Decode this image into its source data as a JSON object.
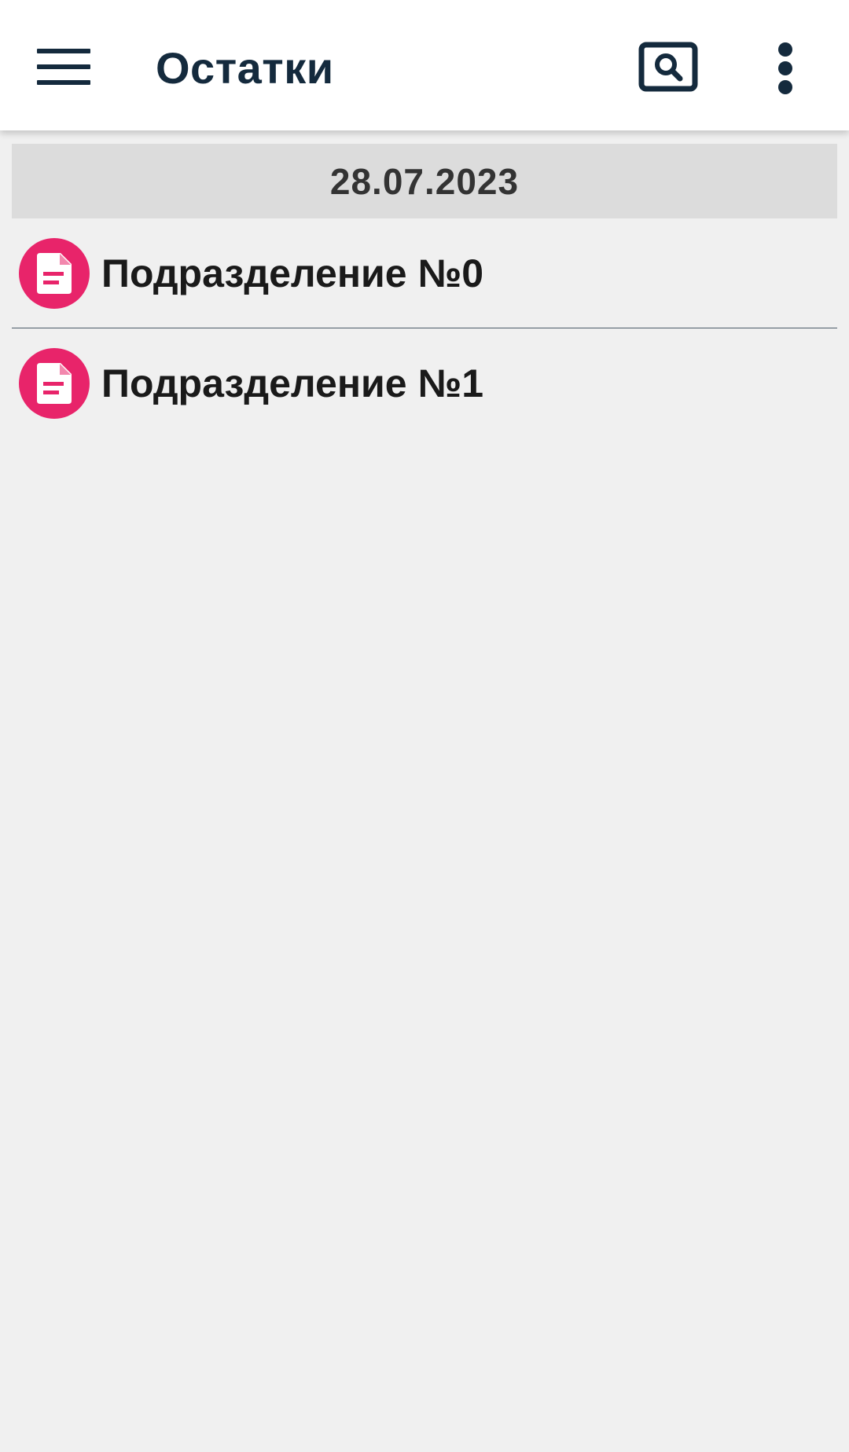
{
  "app_bar": {
    "menu_icon": "hamburger-menu-icon",
    "title": "Остатки",
    "search_icon": "search-icon",
    "more_icon": "more-vert-icon"
  },
  "list": {
    "date_header": "28.07.2023",
    "items": [
      {
        "label": "Подразделение №0",
        "icon": "document-icon"
      },
      {
        "label": "Подразделение №1",
        "icon": "document-icon"
      }
    ]
  },
  "colors": {
    "primary_dark": "#142a3d",
    "accent_pink": "#e8246a",
    "background": "#f0f0f0",
    "date_header_bg": "#dcdcdc"
  }
}
